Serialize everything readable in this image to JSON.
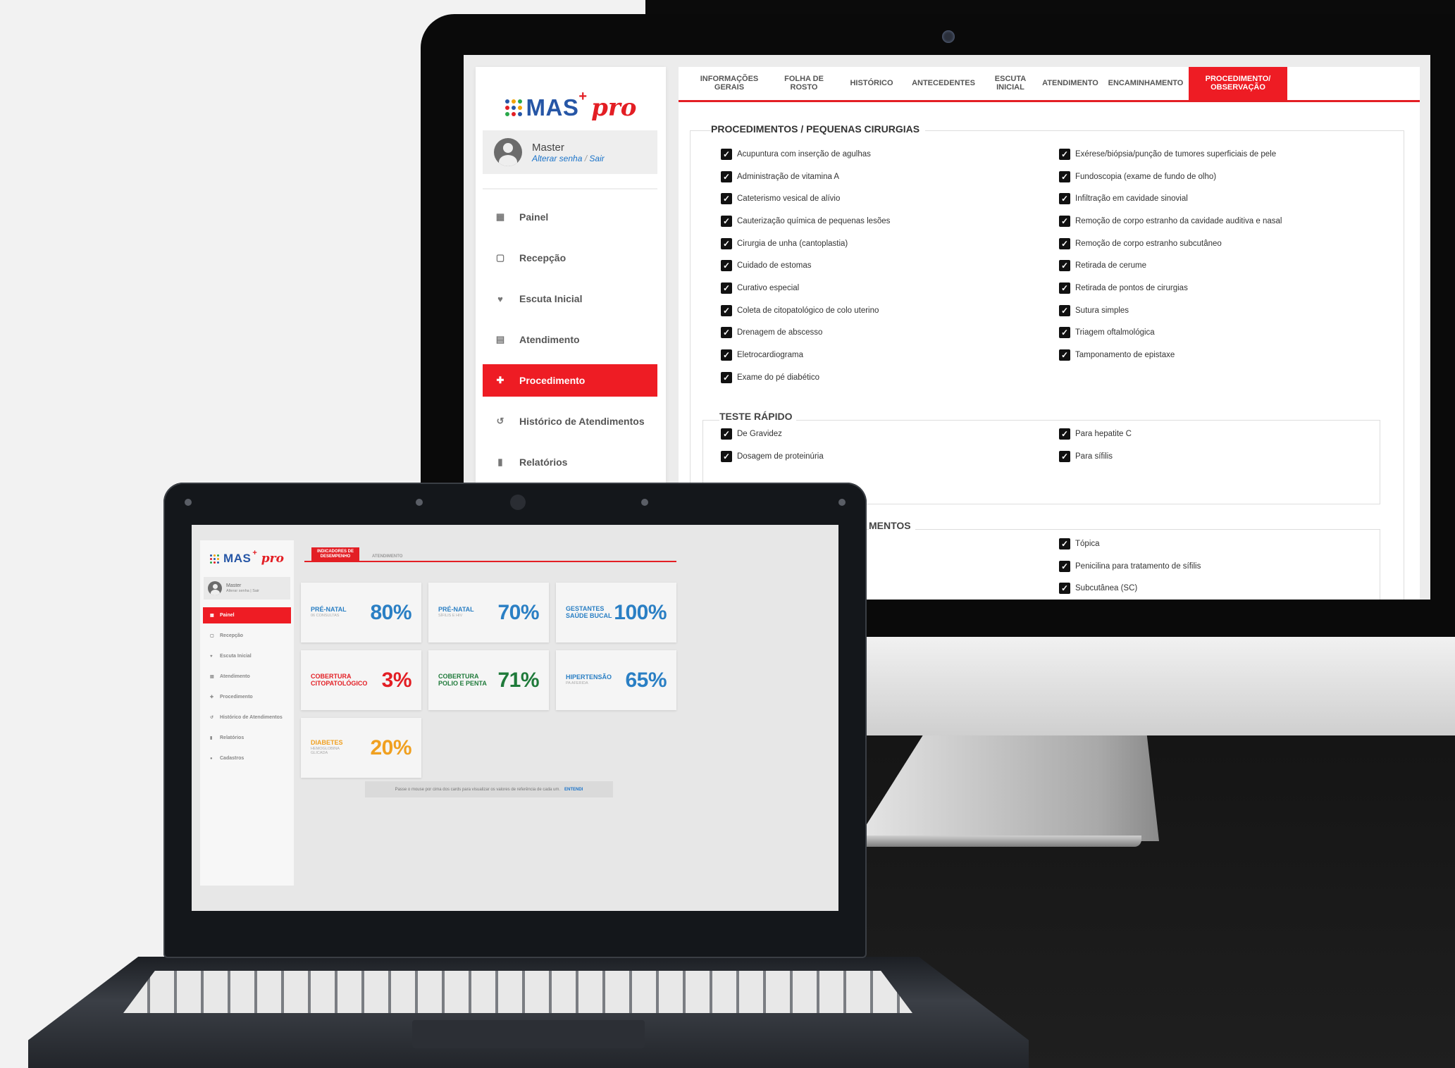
{
  "brand": {
    "name": "MAS",
    "plus": "+",
    "suffix": "pro",
    "dot_colors": [
      "#2656a6",
      "#f4a300",
      "#2aa84a",
      "#e31e24",
      "#2656a6",
      "#f4a300",
      "#2aa84a",
      "#e31e24",
      "#2656a6"
    ]
  },
  "colors": {
    "accent": "#ee1c24",
    "blue": "#2a7fc4",
    "green": "#1f7a3a",
    "orange": "#f0a020",
    "red": "#e31e24"
  },
  "desktop": {
    "user": {
      "name": "Master",
      "change_password": "Alterar senha",
      "separator": "/",
      "logout": "Sair"
    },
    "nav": [
      {
        "label": "Painel",
        "icon": "dashboard-icon",
        "glyph": "▦"
      },
      {
        "label": "Recepção",
        "icon": "clipboard-icon",
        "glyph": "▢"
      },
      {
        "label": "Escuta Inicial",
        "icon": "heart-icon",
        "glyph": "♥"
      },
      {
        "label": "Atendimento",
        "icon": "clipboard-list-icon",
        "glyph": "▤"
      },
      {
        "label": "Procedimento",
        "icon": "medkit-icon",
        "glyph": "✚",
        "active": true
      },
      {
        "label": "Histórico de Atendimentos",
        "icon": "history-icon",
        "glyph": "↺"
      },
      {
        "label": "Relatórios",
        "icon": "file-icon",
        "glyph": "▮"
      }
    ],
    "tabs": [
      {
        "label": "INFORMAÇÕES\nGERAIS"
      },
      {
        "label": "FOLHA DE\nROSTO"
      },
      {
        "label": "HISTÓRICO"
      },
      {
        "label": "ANTECEDENTES"
      },
      {
        "label": "ESCUTA\nINICIAL"
      },
      {
        "label": "ATENDIMENTO"
      },
      {
        "label": "ENCAMINHAMENTO"
      },
      {
        "label": "PROCEDIMENTO/\nOBSERVAÇÃO",
        "active": true
      }
    ],
    "section_title": "PROCEDIMENTOS / PEQUENAS CIRURGIAS",
    "procedures_left": [
      "Acupuntura com inserção de agulhas",
      "Administração de vitamina A",
      "Cateterismo vesical de alívio",
      "Cauterização química de pequenas lesões",
      "Cirurgia de unha (cantoplastia)",
      "Cuidado de estomas",
      "Curativo especial",
      "Coleta de citopatológico de colo uterino",
      "Drenagem de abscesso",
      "Eletrocardiograma",
      "Exame do pé diabético"
    ],
    "procedures_right": [
      "Exérese/biópsia/punção de tumores superficiais de pele",
      "Fundoscopia (exame de fundo de olho)",
      "Infiltração em cavidade sinovial",
      "Remoção de corpo estranho da cavidade auditiva e nasal",
      "Remoção de corpo estranho subcutâneo",
      "Retirada de cerume",
      "Retirada de pontos de cirurgias",
      "Sutura simples",
      "Triagem oftalmológica",
      "Tamponamento de epistaxe"
    ],
    "rapid_test_title": "TESTE RÁPIDO",
    "rapid_left": [
      "De Gravidez",
      "Dosagem de proteinúria"
    ],
    "rapid_right": [
      "Para hepatite C",
      "Para sífilis"
    ],
    "meds_title_partial": "MENTOS",
    "meds_right": [
      "Tópica",
      "Penicilina para tratamento de sífilis",
      "Subcutânea (SC)"
    ]
  },
  "laptop": {
    "user": {
      "name": "Master",
      "links": "Alterar senha | Sair"
    },
    "nav": [
      {
        "label": "Painel",
        "glyph": "▦",
        "active": true
      },
      {
        "label": "Recepção",
        "glyph": "▢"
      },
      {
        "label": "Escuta Inicial",
        "glyph": "♥"
      },
      {
        "label": "Atendimento",
        "glyph": "▤"
      },
      {
        "label": "Procedimento",
        "glyph": "✚"
      },
      {
        "label": "Histórico de Atendimentos",
        "glyph": "↺"
      },
      {
        "label": "Relatórios",
        "glyph": "▮"
      },
      {
        "label": "Cadastros",
        "glyph": "●"
      }
    ],
    "tabs": [
      {
        "label": "INDICADORES DE\nDESEMPENHO",
        "active": true
      },
      {
        "label": "ATENDIMENTO"
      }
    ],
    "cards": [
      {
        "label": "PRÉ-NATAL",
        "sub": "06 CONSULTAS",
        "value": "80%",
        "color": "#2a7fc4"
      },
      {
        "label": "PRÉ-NATAL",
        "sub": "SÍFILIS E HIV",
        "value": "70%",
        "color": "#2a7fc4"
      },
      {
        "label": "GESTANTES\nSAÚDE BUCAL",
        "sub": "",
        "value": "100%",
        "color": "#2a7fc4"
      },
      {
        "label": "COBERTURA\nCITOPATOLÓGICO",
        "sub": "",
        "value": "3%",
        "color": "#e31e24"
      },
      {
        "label": "COBERTURA\nPOLIO E PENTA",
        "sub": "",
        "value": "71%",
        "color": "#1f7a3a"
      },
      {
        "label": "HIPERTENSÃO",
        "sub": "PA AFERIDA",
        "value": "65%",
        "color": "#2a7fc4"
      },
      {
        "label": "DIABETES",
        "sub": "HEMOGLOBINA\nGLICADA",
        "value": "20%",
        "color": "#f0a020"
      }
    ],
    "footer_text": "Passe o mouse por cima dos cards para visualizar os valores de referência de cada um.",
    "footer_link": "ENTENDI"
  }
}
